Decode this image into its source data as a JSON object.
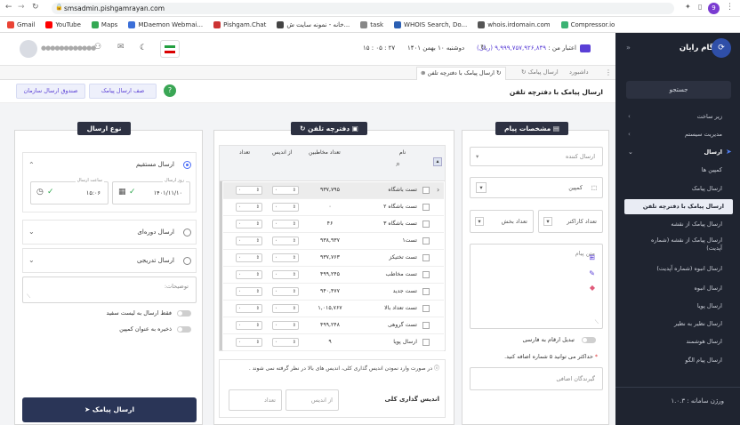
{
  "browser": {
    "url": "smsadmin.pishgamrayan.com",
    "bookmarks": [
      "Gmail",
      "YouTube",
      "Maps",
      "MDaemon Webmai...",
      "Pishgam.Chat",
      "خانه - نمونه سایت ش...",
      "task",
      "WHOIS Search, Do...",
      "whois.irdomain.com",
      "Compressor.io"
    ],
    "profile_initial": "9"
  },
  "sidebar": {
    "brand": "پیشگام رایان",
    "search_label": "جستجو",
    "items": [
      {
        "label": "زیر ساخت"
      },
      {
        "label": "مدیریت سیستم"
      },
      {
        "label": "ارسال"
      },
      {
        "label": "کمپین ها"
      },
      {
        "label": "ارسال پیامک"
      },
      {
        "label": "ارسال پیامک با دفترچه تلفن"
      },
      {
        "label": "ارسال پیامک از نقشه"
      },
      {
        "label": "ارسال پیامک از نقشه (شماره آپدیت)"
      },
      {
        "label": "ارسال انبوه (شماره آپدیت)"
      },
      {
        "label": "ارسال انبوه"
      },
      {
        "label": "ارسال پویا"
      },
      {
        "label": "ارسال نظیر به نظیر"
      },
      {
        "label": "ارسال هوشمند"
      },
      {
        "label": "ارسال پیام الگو"
      }
    ],
    "version_label": "ورژن سامانه :",
    "version_value": "۱.۰.۳"
  },
  "topbar": {
    "credit_label": "اعتبار من :",
    "credit_value": "۹,۹۹۹,۷۵۷,۹۲۶,۸۴۹ (ریال)",
    "date": "دوشنبه ۱۰ بهمن ۱۴۰۱",
    "time": "۱۵ : ۰۵ : ۲۷",
    "user_name": "●●●●●●●●●●●●"
  },
  "tabs": {
    "dashboard": "داشبورد",
    "send_sms": "ارسال پیامک",
    "phonebook_send": "ارسال پیامک با دفترچه تلفن"
  },
  "actionbar": {
    "page_title": "ارسال پیامک با دفترچه تلفن",
    "queue_button": "صف ارسال پیامک",
    "org_inbox_button": "صندوق ارسال سازمان"
  },
  "message_panel": {
    "title": "مشخصات پیام",
    "sender_placeholder": "ارسال کننده",
    "campaign_label": "کمپین",
    "char_count_label": "تعداد کاراکتر",
    "parts_label": "تعداد بخش",
    "message_placeholder": "متن پیام",
    "persian_digits_label": "تبدیل ارقام به فارسی",
    "extra_numbers_note": "حداکثر می توانید ۵ شماره اضافه کنید.",
    "extra_recipients_placeholder": "گیرندگان اضافی"
  },
  "phonebook_panel": {
    "title": "دفترچه تلفن",
    "columns": {
      "name": "نام",
      "contacts": "تعداد مخاطبین",
      "from_index": "از اندیس",
      "count": "تعداد"
    },
    "rows": [
      {
        "name": "تست باشگاه",
        "contacts": "۹۳۷,۷۹۵"
      },
      {
        "name": "تست باشگاه ۲",
        "contacts": "۰"
      },
      {
        "name": "تست باشگاه ۳",
        "contacts": "۴۶"
      },
      {
        "name": "تست۱",
        "contacts": "۹۳۸,۹۳۷"
      },
      {
        "name": "تست تختیکز",
        "contacts": "۹۳۷,۷۶۳"
      },
      {
        "name": "تست مخاطب",
        "contacts": "۴۹۹,۲۴۵"
      },
      {
        "name": "تست جدید",
        "contacts": "۹۴۰,۴۷۷"
      },
      {
        "name": "تست تعداد بالا",
        "contacts": "۱,۰۱۵,۷۶۷"
      },
      {
        "name": "تست گروهی",
        "contacts": "۴۹۹,۲۴۸"
      },
      {
        "name": "ارسال پویا",
        "contacts": "۹"
      }
    ],
    "spinner_value": "۰",
    "note": "در صورت وارد نمودن اندیس گذاری کلی، اندیس های بالا در نظر گرفته نمی شوند .",
    "global_index_label": "اندیس گذاری کلی",
    "from_index_placeholder": "از اندیس",
    "count_placeholder": "تعداد"
  },
  "send_type_panel": {
    "title": "نوع ارسال",
    "immediate_label": "ارسال مستقیم",
    "send_date_label": "روز ارسال",
    "send_date_value": "۱۴۰۱/۱۱/۱۰",
    "send_time_label": "ساعت ارسال",
    "send_time_value": "۱۵:۰۶",
    "periodic_label": "ارسال دوره‌ای",
    "gradual_label": "ارسال تدریجی",
    "description_placeholder": "توضیحات:",
    "whitelist_only_label": "فقط ارسال به لیست سفید",
    "save_as_campaign_label": "ذخیره به عنوان کمپین",
    "send_button": "ارسال پیامک"
  },
  "colors": {
    "sidebar_bg": "#1f2430",
    "accent": "#2d3142",
    "purple": "#5a3fd6",
    "check_green": "#2fa84f",
    "send_button": "#2a3557"
  }
}
